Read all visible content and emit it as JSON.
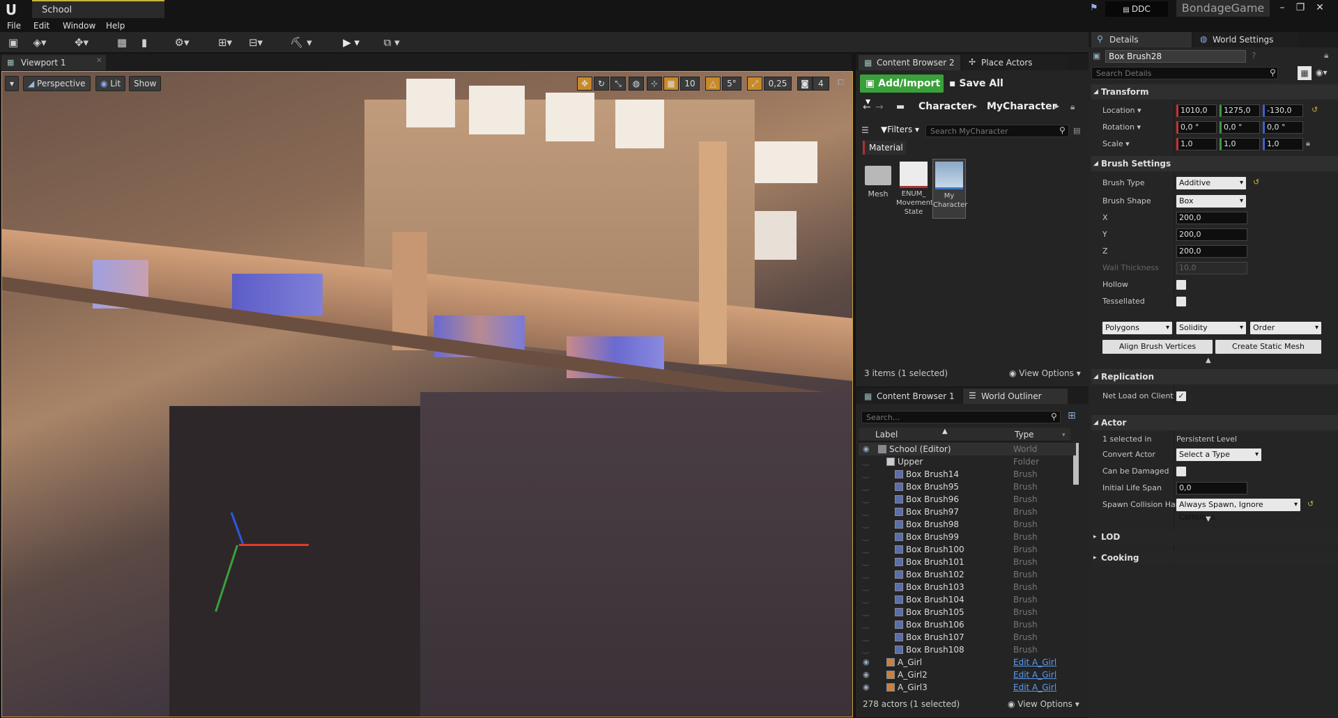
{
  "window": {
    "document_tab": "School",
    "ddc_label": "DDC",
    "game_name": "BondageGame",
    "buttons": [
      "minimize",
      "restore",
      "close"
    ]
  },
  "menu": [
    "File",
    "Edit",
    "Window",
    "Help"
  ],
  "toolbar": {
    "icons": [
      "save-icon",
      "source-control-icon",
      "modes-icon",
      "content-icon",
      "marketplace-icon",
      "settings-icon",
      "blueprints-icon",
      "cinematics-icon",
      "build-icon",
      "play-icon",
      "launch-icon"
    ]
  },
  "viewport": {
    "tab_label": "Viewport 1",
    "perspective_label": "Perspective",
    "lit_label": "Lit",
    "show_label": "Show",
    "grid_snap": "10",
    "rotation_snap": "5°",
    "scale_snap": "0,25",
    "camera_speed": "4"
  },
  "content_browser_top": {
    "tabs": [
      "Content Browser 2",
      "Place Actors"
    ],
    "add_import_label": "Add/Import",
    "save_all_label": "Save All",
    "breadcrumb": [
      "Character",
      "MyCharacter"
    ],
    "filters_label": "Filters",
    "search_placeholder": "Search MyCharacter",
    "filter_chip": "Material",
    "assets": [
      {
        "label": "Mesh"
      },
      {
        "label": "ENUM_\nMovement\nState"
      },
      {
        "label": "My\nCharacter"
      }
    ],
    "status": "3 items (1 selected)",
    "view_options_label": "View Options"
  },
  "outliner": {
    "tabs": [
      "Content Browser 1",
      "World Outliner"
    ],
    "search_placeholder": "Search...",
    "col_label": "Label",
    "col_type": "Type",
    "rows": [
      {
        "label": "School (Editor)",
        "type": "World"
      },
      {
        "label": "Upper",
        "type": "Folder"
      },
      {
        "label": "Box Brush14",
        "type": "Brush"
      },
      {
        "label": "Box Brush95",
        "type": "Brush"
      },
      {
        "label": "Box Brush96",
        "type": "Brush"
      },
      {
        "label": "Box Brush97",
        "type": "Brush"
      },
      {
        "label": "Box Brush98",
        "type": "Brush"
      },
      {
        "label": "Box Brush99",
        "type": "Brush"
      },
      {
        "label": "Box Brush100",
        "type": "Brush"
      },
      {
        "label": "Box Brush101",
        "type": "Brush"
      },
      {
        "label": "Box Brush102",
        "type": "Brush"
      },
      {
        "label": "Box Brush103",
        "type": "Brush"
      },
      {
        "label": "Box Brush104",
        "type": "Brush"
      },
      {
        "label": "Box Brush105",
        "type": "Brush"
      },
      {
        "label": "Box Brush106",
        "type": "Brush"
      },
      {
        "label": "Box Brush107",
        "type": "Brush"
      },
      {
        "label": "Box Brush108",
        "type": "Brush"
      },
      {
        "label": "A_Girl",
        "type": "Edit A_Girl"
      },
      {
        "label": "A_Girl2",
        "type": "Edit A_Girl"
      },
      {
        "label": "A_Girl3",
        "type": "Edit A_Girl"
      }
    ],
    "status": "278 actors (1 selected)",
    "view_options_label": "View Options"
  },
  "details": {
    "tabs": [
      "Details",
      "World Settings"
    ],
    "actor_name": "Box Brush28",
    "search_placeholder": "Search Details",
    "transform": {
      "header": "Transform",
      "location_label": "Location",
      "rotation_label": "Rotation",
      "scale_label": "Scale",
      "location": [
        "1010,0",
        "1275,0",
        "-130,0"
      ],
      "rotation": [
        "0,0 °",
        "0,0 °",
        "0,0 °"
      ],
      "scale": [
        "1,0",
        "1,0",
        "1,0"
      ]
    },
    "brush": {
      "header": "Brush Settings",
      "type_label": "Brush Type",
      "type_value": "Additive",
      "shape_label": "Brush Shape",
      "shape_value": "Box",
      "x_label": "X",
      "x": "200,0",
      "y_label": "Y",
      "y": "200,0",
      "z_label": "Z",
      "z": "200,0",
      "wall_label": "Wall Thickness",
      "wall": "10,0",
      "hollow_label": "Hollow",
      "tess_label": "Tessellated",
      "combo1": "Polygons",
      "combo2": "Solidity",
      "combo3": "Order",
      "align_label": "Align Brush Vertices",
      "static_mesh_label": "Create Static Mesh"
    },
    "replication": {
      "header": "Replication",
      "net_load_label": "Net Load on Client"
    },
    "actor": {
      "header": "Actor",
      "selected_label": "1 selected in",
      "selected_value": "Persistent Level",
      "convert_label": "Convert Actor",
      "convert_value": "Select a Type",
      "damage_label": "Can be Damaged",
      "lifespan_label": "Initial Life Span",
      "lifespan_value": "0,0",
      "spawn_label": "Spawn Collision Han",
      "spawn_value": "Always Spawn, Ignore Collisions"
    },
    "lod_header": "LOD",
    "cooking_header": "Cooking"
  }
}
